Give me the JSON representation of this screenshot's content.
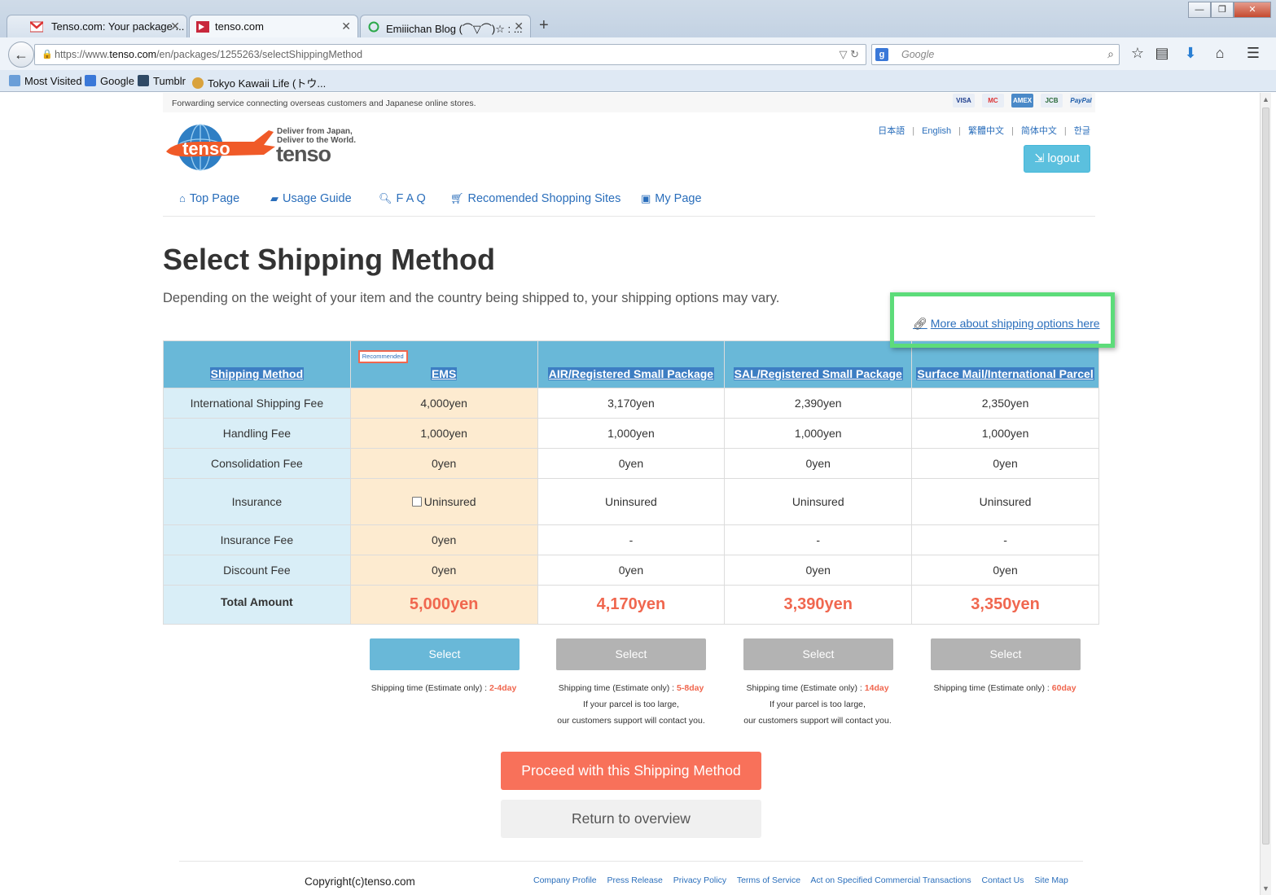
{
  "browser": {
    "tabs": [
      {
        "title": "Tenso.com: Your package ...",
        "active": false,
        "favicon": "gmail-icon"
      },
      {
        "title": "tenso.com",
        "active": true,
        "favicon": "tenso-icon"
      },
      {
        "title": "Emiiichan Blog (⌒▽⌒)☆ : ...",
        "active": false,
        "favicon": "loading-icon"
      }
    ],
    "url_prefix": "https://www.",
    "url_domain": "tenso.com",
    "url_path": "/en/packages/1255263/selectShippingMethod",
    "search_placeholder": "Google",
    "bookmarks": [
      "Most Visited",
      "Google",
      "Tumblr",
      "Tokyo Kawaii Life (トウ..."
    ]
  },
  "site": {
    "tagline": "Forwarding service connecting overseas customers and Japanese online stores.",
    "cards": [
      "VISA",
      "MC",
      "AMEX",
      "JCB",
      "PayPal"
    ],
    "logo_slogan_1": "Deliver from Japan,",
    "logo_slogan_2": "Deliver to the World.",
    "logo_word": "tenso",
    "languages": [
      "日本語",
      "English",
      "繁體中文",
      "简体中文",
      "한글"
    ],
    "logout_label": "logout",
    "nav": [
      {
        "label": "Top Page",
        "icon": "home-icon"
      },
      {
        "label": "Usage Guide",
        "icon": "book-icon"
      },
      {
        "label": "F A Q",
        "icon": "search-icon"
      },
      {
        "label": "Recomended Shopping Sites",
        "icon": "cart-icon"
      },
      {
        "label": "My Page",
        "icon": "page-icon"
      }
    ]
  },
  "main": {
    "title": "Select Shipping Method",
    "subtitle": "Depending on the weight of your item and the country being shipped to, your shipping options may vary.",
    "more_link": "More about shipping options here",
    "table": {
      "header_label": "Shipping Method",
      "recommended_badge": "Recommended",
      "methods": [
        "EMS",
        "AIR/Registered Small Package",
        "SAL/Registered Small Package",
        "Surface Mail/International Parcel"
      ],
      "rows": [
        {
          "label": "International Shipping Fee",
          "values": [
            "4,000yen",
            "3,170yen",
            "2,390yen",
            "2,350yen"
          ]
        },
        {
          "label": "Handling Fee",
          "values": [
            "1,000yen",
            "1,000yen",
            "1,000yen",
            "1,000yen"
          ]
        },
        {
          "label": "Consolidation Fee",
          "values": [
            "0yen",
            "0yen",
            "0yen",
            "0yen"
          ]
        },
        {
          "label": "Insurance",
          "values": [
            "Uninsured",
            "Uninsured",
            "Uninsured",
            "Uninsured"
          ]
        },
        {
          "label": "Insurance Fee",
          "values": [
            "0yen",
            "-",
            "-",
            "-"
          ]
        },
        {
          "label": "Discount Fee",
          "values": [
            "0yen",
            "0yen",
            "0yen",
            "0yen"
          ]
        }
      ],
      "total_label": "Total Amount",
      "totals": [
        "5,000yen",
        "4,170yen",
        "3,390yen",
        "3,350yen"
      ]
    },
    "select_label": "Select",
    "shipping_time_label": "Shipping time (Estimate only) : ",
    "shipping_days": [
      "2-4day",
      "5-8day",
      "14day",
      "60day"
    ],
    "large_note_1": "If your parcel is too large,",
    "large_note_2": "our customers support will contact you.",
    "proceed_label": "Proceed with this Shipping Method",
    "return_label": "Return to overview"
  },
  "footer": {
    "copyright": "Copyright(c)tenso.com",
    "links": [
      "Company Profile",
      "Press Release",
      "Privacy Policy",
      "Terms of Service",
      "Act on Specified Commercial Transactions",
      "Contact Us",
      "Site Map"
    ]
  },
  "colors": {
    "accent": "#69b8d8",
    "total": "#f0674f",
    "proceed": "#f8715a",
    "highlight_box": "#5ddc7a"
  }
}
